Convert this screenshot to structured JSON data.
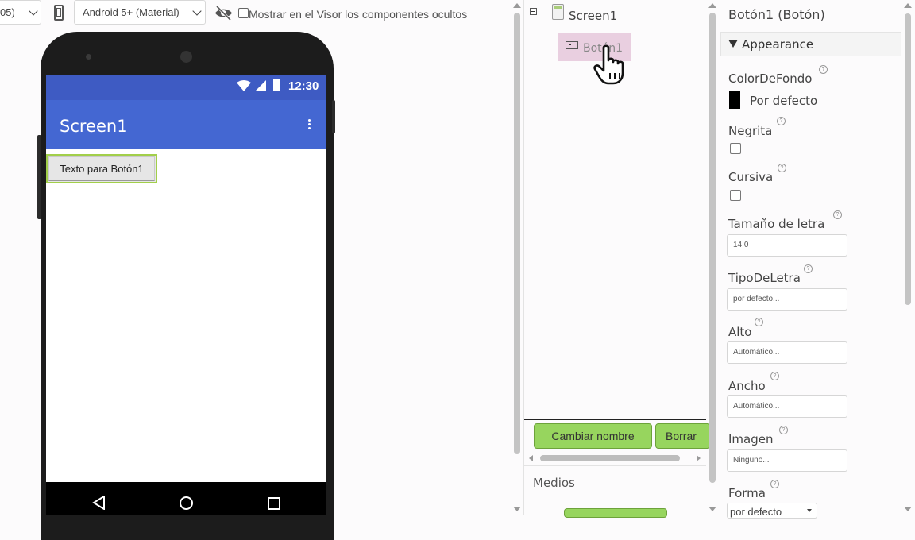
{
  "toolbar": {
    "size_select_value": "05)",
    "theme_select_value": "Android 5+ (Material)",
    "hidden_components_label": "Mostrar en el Visor los componentes ocultos"
  },
  "phone": {
    "status_time": "12:30",
    "screen_title": "Screen1",
    "button_text": "Texto para Botón1"
  },
  "components": {
    "root_label": "Screen1",
    "child_label": "Botón1",
    "rename_button": "Cambiar nombre",
    "delete_button": "Borrar",
    "media_label": "Medios"
  },
  "properties": {
    "header": "Botón1 (Botón)",
    "section": "Appearance",
    "bg_color_label": "ColorDeFondo",
    "bg_color_value": "Por defecto",
    "bold_label": "Negrita",
    "italic_label": "Cursiva",
    "font_size_label": "Tamaño de letra",
    "font_size_value": "14.0",
    "font_type_label": "TipoDeLetra",
    "font_type_value": "por defecto...",
    "height_label": "Alto",
    "height_value": "Automático...",
    "width_label": "Ancho",
    "width_value": "Automático...",
    "image_label": "Imagen",
    "image_value": "Ninguno...",
    "shape_label": "Forma",
    "shape_value": "por defecto"
  },
  "colors": {
    "statusbar": "#3e5bc3",
    "appbar": "#4467d2",
    "green_button": "#97d55e",
    "selected_component": "#e9cfe0"
  }
}
